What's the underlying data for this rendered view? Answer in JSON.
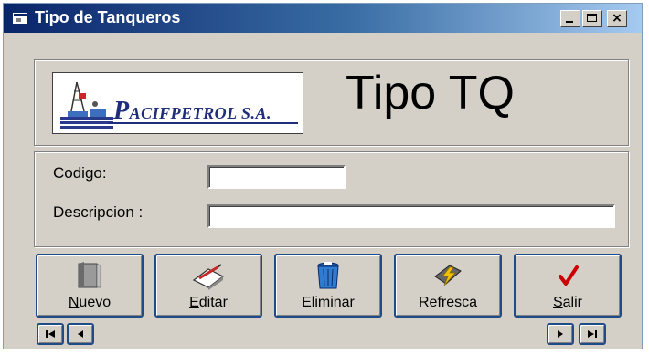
{
  "window": {
    "title": "Tipo de Tanqueros",
    "controls": {
      "minimize": "_",
      "maximize": "□",
      "close": "×"
    }
  },
  "header": {
    "logo_text_initial": "P",
    "logo_text_rest": "ACIFPETROL S.A.",
    "big_title": "Tipo TQ"
  },
  "form": {
    "codigo_label": "Codigo:",
    "codigo_value": "",
    "descripcion_label": "Descripcion :",
    "descripcion_value": ""
  },
  "toolbar": {
    "nuevo": {
      "key": "N",
      "rest": "uevo"
    },
    "editar": {
      "key": "E",
      "rest": "ditar"
    },
    "eliminar": "Eliminar",
    "refresca": "Refresca",
    "salir": {
      "key": "S",
      "rest": "alir"
    }
  },
  "icons": {
    "nuevo": "new-document-icon",
    "editar": "edit-pencil-icon",
    "eliminar": "trash-can-icon",
    "refresca": "lightning-refresh-icon",
    "salir": "checkmark-icon",
    "first": "first-record-icon",
    "prev": "previous-record-icon",
    "next": "next-record-icon",
    "last": "last-record-icon"
  },
  "colors": {
    "titlebar_start": "#0a246a",
    "titlebar_end": "#a6caf0",
    "window_bg": "#d4d0c8",
    "button_border": "#1f4c86",
    "logo_blue": "#1f2e7a",
    "salir_check": "#cc0000"
  }
}
